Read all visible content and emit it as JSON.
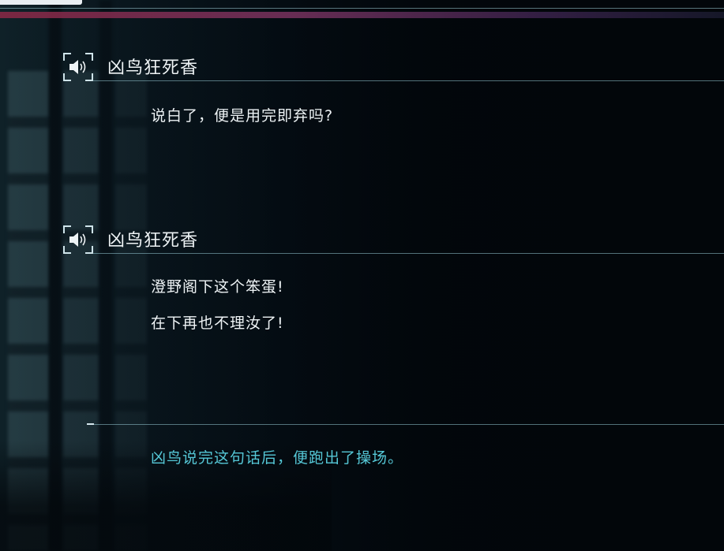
{
  "backlog": {
    "entries": [
      {
        "speaker": "凶鸟狂死香",
        "voice_icon": "speaker-icon",
        "lines": [
          "说白了，便是用完即弃吗?"
        ]
      },
      {
        "speaker": "凶鸟狂死香",
        "voice_icon": "speaker-icon",
        "lines": [
          "澄野阁下这个笨蛋!",
          "在下再也不理汝了!"
        ]
      }
    ],
    "narration": "凶鸟说完这句话后，便跑出了操场。"
  },
  "colors": {
    "dialogue_text": "#eef3f5",
    "narration_text": "#55c7d6",
    "divider": "#96c8d4",
    "header_band": "#8c2846"
  }
}
